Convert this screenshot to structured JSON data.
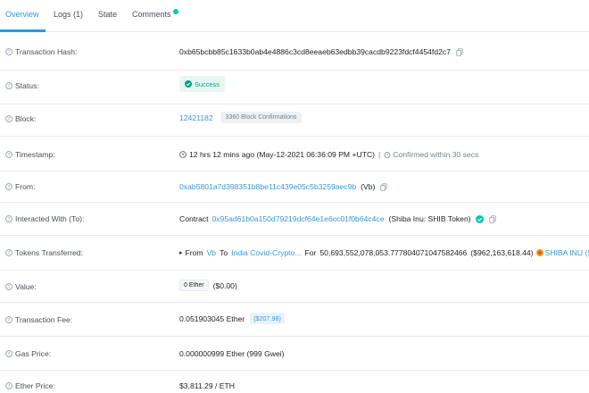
{
  "tabs": [
    {
      "label": "Overview",
      "active": true
    },
    {
      "label": "Logs (1)",
      "active": false
    },
    {
      "label": "State",
      "active": false
    },
    {
      "label": "Comments",
      "active": false
    }
  ],
  "rows": {
    "tx_hash": {
      "label": "Transaction Hash:",
      "value": "0xb65bcbb85c1633b0ab4e4886c3cd8eeaeb63edbb39cacdb9223fdcf4454fd2c7"
    },
    "status": {
      "label": "Status:",
      "value": "Success"
    },
    "block": {
      "label": "Block:",
      "value": "12421182",
      "confirmations": "3360 Block Confirmations"
    },
    "timestamp": {
      "label": "Timestamp:",
      "value": "12 hrs 12 mins ago (May-12-2021 06:36:09 PM +UTC)",
      "separator": "|",
      "confirmed": "Confirmed within 30 secs"
    },
    "from": {
      "label": "From:",
      "address": "0xab5801a7d398351b8be11c439e05c5b3259aec9b",
      "tag": "(Vb)"
    },
    "interacted": {
      "label": "Interacted With (To):",
      "prefix": "Contract",
      "address": "0x95ad61b0a150d79219dcf64e1e6cc01f0b64c4ce",
      "name": "(Shiba Inu: SHIB Token)"
    },
    "tokens": {
      "label": "Tokens Transferred:",
      "from_text": "From",
      "from_name": "Vb",
      "to_text": "To",
      "to_name": "India Covid-Crypto...",
      "for_text": "For",
      "amount": "50,693,552,078,053.777804071047582466",
      "usd": "($962,163,618.44)",
      "token": "SHIBA INU (SHIB)"
    },
    "value": {
      "label": "Value:",
      "amount": "0 Ether",
      "usd": "($0.00)"
    },
    "fee": {
      "label": "Transaction Fee:",
      "amount": "0.051903045 Ether",
      "usd": "($207.98)"
    },
    "gas_price": {
      "label": "Gas Price:",
      "value": "0.000000999 Ether (999 Gwei)"
    },
    "ether_price": {
      "label": "Ether Price:",
      "value": "$3,811.29 / ETH"
    }
  },
  "colors": {
    "accent": "#3498db",
    "success": "#00c9a7",
    "shib": "#f39c12"
  }
}
